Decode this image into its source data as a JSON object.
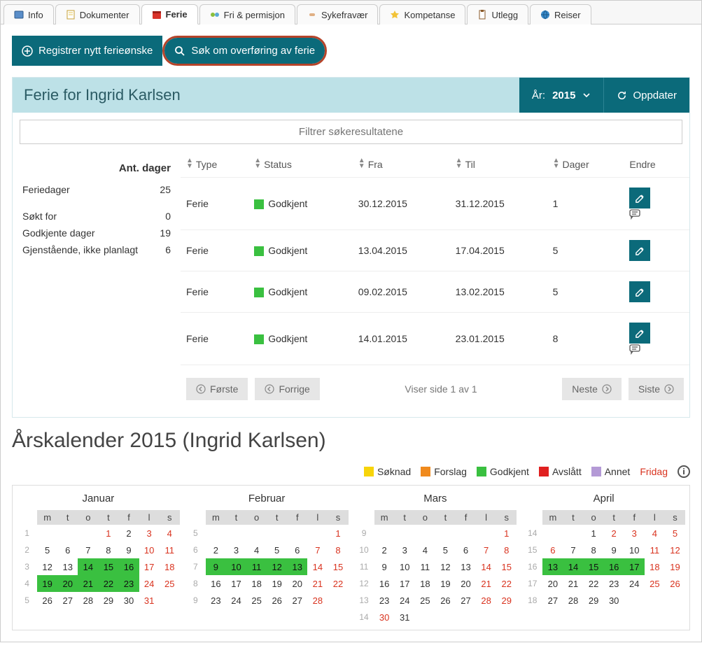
{
  "tabs": [
    {
      "label": "Info",
      "icon": "info-icon"
    },
    {
      "label": "Dokumenter",
      "icon": "doc-icon"
    },
    {
      "label": "Ferie",
      "icon": "calendar-icon",
      "active": true
    },
    {
      "label": "Fri & permisjon",
      "icon": "leave-icon"
    },
    {
      "label": "Sykefravær",
      "icon": "sick-icon"
    },
    {
      "label": "Kompetanse",
      "icon": "star-icon"
    },
    {
      "label": "Utlegg",
      "icon": "clipboard-icon"
    },
    {
      "label": "Reiser",
      "icon": "globe-icon"
    }
  ],
  "toolbar": {
    "register_label": "Registrer nytt ferieønske",
    "transfer_label": "Søk om overføring av ferie"
  },
  "panel": {
    "title": "Ferie for Ingrid Karlsen",
    "year_label": "År:",
    "year_value": "2015",
    "refresh_label": "Oppdater",
    "filter_placeholder": "Filtrer søkeresultatene"
  },
  "sidebar": {
    "title": "Ant. dager",
    "rows": [
      {
        "label": "Feriedager",
        "value": "25"
      },
      {
        "label": "Søkt for",
        "value": "0"
      },
      {
        "label": "Godkjente dager",
        "value": "19"
      },
      {
        "label": "Gjenstående, ikke planlagt",
        "value": "6"
      }
    ]
  },
  "table": {
    "headers": {
      "type": "Type",
      "status": "Status",
      "fra": "Fra",
      "til": "Til",
      "dager": "Dager",
      "endre": "Endre"
    },
    "rows": [
      {
        "type": "Ferie",
        "status": "Godkjent",
        "fra": "30.12.2015",
        "til": "31.12.2015",
        "dager": "1",
        "comment": true
      },
      {
        "type": "Ferie",
        "status": "Godkjent",
        "fra": "13.04.2015",
        "til": "17.04.2015",
        "dager": "5",
        "comment": false
      },
      {
        "type": "Ferie",
        "status": "Godkjent",
        "fra": "09.02.2015",
        "til": "13.02.2015",
        "dager": "5",
        "comment": false
      },
      {
        "type": "Ferie",
        "status": "Godkjent",
        "fra": "14.01.2015",
        "til": "23.01.2015",
        "dager": "8",
        "comment": true
      }
    ]
  },
  "pagination": {
    "first": "Første",
    "prev": "Forrige",
    "info": "Viser side 1 av 1",
    "next": "Neste",
    "last": "Siste"
  },
  "calendar": {
    "title": "Årskalender 2015 (Ingrid Karlsen)",
    "legend": {
      "soknad": "Søknad",
      "forslag": "Forslag",
      "godkjent": "Godkjent",
      "avslatt": "Avslått",
      "annet": "Annet",
      "fridag": "Fridag"
    },
    "colors": {
      "soknad": "#f7d40a",
      "forslag": "#f08a1d",
      "godkjent": "#3ac040",
      "avslatt": "#e02020",
      "annet": "#b49ad6"
    },
    "dow": [
      "m",
      "t",
      "o",
      "t",
      "f",
      "l",
      "s"
    ],
    "months": [
      {
        "name": "Januar",
        "weeks": [
          {
            "wk": "1",
            "days": [
              {
                "n": "",
                "c": ""
              },
              {
                "n": "",
                "c": ""
              },
              {
                "n": "",
                "c": ""
              },
              {
                "n": "1",
                "c": "red"
              },
              {
                "n": "2",
                "c": ""
              },
              {
                "n": "3",
                "c": "red"
              },
              {
                "n": "4",
                "c": "red"
              }
            ]
          },
          {
            "wk": "2",
            "days": [
              {
                "n": "5",
                "c": ""
              },
              {
                "n": "6",
                "c": ""
              },
              {
                "n": "7",
                "c": ""
              },
              {
                "n": "8",
                "c": ""
              },
              {
                "n": "9",
                "c": ""
              },
              {
                "n": "10",
                "c": "red"
              },
              {
                "n": "11",
                "c": "red"
              }
            ]
          },
          {
            "wk": "3",
            "days": [
              {
                "n": "12",
                "c": ""
              },
              {
                "n": "13",
                "c": ""
              },
              {
                "n": "14",
                "c": "godkjent"
              },
              {
                "n": "15",
                "c": "godkjent"
              },
              {
                "n": "16",
                "c": "godkjent"
              },
              {
                "n": "17",
                "c": "red"
              },
              {
                "n": "18",
                "c": "red"
              }
            ]
          },
          {
            "wk": "4",
            "days": [
              {
                "n": "19",
                "c": "godkjent"
              },
              {
                "n": "20",
                "c": "godkjent"
              },
              {
                "n": "21",
                "c": "godkjent"
              },
              {
                "n": "22",
                "c": "godkjent"
              },
              {
                "n": "23",
                "c": "godkjent"
              },
              {
                "n": "24",
                "c": "red"
              },
              {
                "n": "25",
                "c": "red"
              }
            ]
          },
          {
            "wk": "5",
            "days": [
              {
                "n": "26",
                "c": ""
              },
              {
                "n": "27",
                "c": ""
              },
              {
                "n": "28",
                "c": ""
              },
              {
                "n": "29",
                "c": ""
              },
              {
                "n": "30",
                "c": ""
              },
              {
                "n": "31",
                "c": "red"
              },
              {
                "n": "",
                "c": ""
              }
            ]
          }
        ]
      },
      {
        "name": "Februar",
        "weeks": [
          {
            "wk": "5",
            "days": [
              {
                "n": "",
                "c": ""
              },
              {
                "n": "",
                "c": ""
              },
              {
                "n": "",
                "c": ""
              },
              {
                "n": "",
                "c": ""
              },
              {
                "n": "",
                "c": ""
              },
              {
                "n": "",
                "c": ""
              },
              {
                "n": "1",
                "c": "red"
              }
            ]
          },
          {
            "wk": "6",
            "days": [
              {
                "n": "2",
                "c": ""
              },
              {
                "n": "3",
                "c": ""
              },
              {
                "n": "4",
                "c": ""
              },
              {
                "n": "5",
                "c": ""
              },
              {
                "n": "6",
                "c": ""
              },
              {
                "n": "7",
                "c": "red"
              },
              {
                "n": "8",
                "c": "red"
              }
            ]
          },
          {
            "wk": "7",
            "days": [
              {
                "n": "9",
                "c": "godkjent"
              },
              {
                "n": "10",
                "c": "godkjent"
              },
              {
                "n": "11",
                "c": "godkjent"
              },
              {
                "n": "12",
                "c": "godkjent"
              },
              {
                "n": "13",
                "c": "godkjent"
              },
              {
                "n": "14",
                "c": "red"
              },
              {
                "n": "15",
                "c": "red"
              }
            ]
          },
          {
            "wk": "8",
            "days": [
              {
                "n": "16",
                "c": ""
              },
              {
                "n": "17",
                "c": ""
              },
              {
                "n": "18",
                "c": ""
              },
              {
                "n": "19",
                "c": ""
              },
              {
                "n": "20",
                "c": ""
              },
              {
                "n": "21",
                "c": "red"
              },
              {
                "n": "22",
                "c": "red"
              }
            ]
          },
          {
            "wk": "9",
            "days": [
              {
                "n": "23",
                "c": ""
              },
              {
                "n": "24",
                "c": ""
              },
              {
                "n": "25",
                "c": ""
              },
              {
                "n": "26",
                "c": ""
              },
              {
                "n": "27",
                "c": ""
              },
              {
                "n": "28",
                "c": "red"
              },
              {
                "n": "",
                "c": ""
              }
            ]
          }
        ]
      },
      {
        "name": "Mars",
        "weeks": [
          {
            "wk": "9",
            "days": [
              {
                "n": "",
                "c": ""
              },
              {
                "n": "",
                "c": ""
              },
              {
                "n": "",
                "c": ""
              },
              {
                "n": "",
                "c": ""
              },
              {
                "n": "",
                "c": ""
              },
              {
                "n": "",
                "c": ""
              },
              {
                "n": "1",
                "c": "red"
              }
            ]
          },
          {
            "wk": "10",
            "days": [
              {
                "n": "2",
                "c": ""
              },
              {
                "n": "3",
                "c": ""
              },
              {
                "n": "4",
                "c": ""
              },
              {
                "n": "5",
                "c": ""
              },
              {
                "n": "6",
                "c": ""
              },
              {
                "n": "7",
                "c": "red"
              },
              {
                "n": "8",
                "c": "red"
              }
            ]
          },
          {
            "wk": "11",
            "days": [
              {
                "n": "9",
                "c": ""
              },
              {
                "n": "10",
                "c": ""
              },
              {
                "n": "11",
                "c": ""
              },
              {
                "n": "12",
                "c": ""
              },
              {
                "n": "13",
                "c": ""
              },
              {
                "n": "14",
                "c": "red"
              },
              {
                "n": "15",
                "c": "red"
              }
            ]
          },
          {
            "wk": "12",
            "days": [
              {
                "n": "16",
                "c": ""
              },
              {
                "n": "17",
                "c": ""
              },
              {
                "n": "18",
                "c": ""
              },
              {
                "n": "19",
                "c": ""
              },
              {
                "n": "20",
                "c": ""
              },
              {
                "n": "21",
                "c": "red"
              },
              {
                "n": "22",
                "c": "red"
              }
            ]
          },
          {
            "wk": "13",
            "days": [
              {
                "n": "23",
                "c": ""
              },
              {
                "n": "24",
                "c": ""
              },
              {
                "n": "25",
                "c": ""
              },
              {
                "n": "26",
                "c": ""
              },
              {
                "n": "27",
                "c": ""
              },
              {
                "n": "28",
                "c": "red"
              },
              {
                "n": "29",
                "c": "red"
              }
            ]
          },
          {
            "wk": "14",
            "days": [
              {
                "n": "30",
                "c": "red"
              },
              {
                "n": "31",
                "c": ""
              },
              {
                "n": "",
                "c": ""
              },
              {
                "n": "",
                "c": ""
              },
              {
                "n": "",
                "c": ""
              },
              {
                "n": "",
                "c": ""
              },
              {
                "n": "",
                "c": ""
              }
            ]
          }
        ]
      },
      {
        "name": "April",
        "weeks": [
          {
            "wk": "14",
            "days": [
              {
                "n": "",
                "c": ""
              },
              {
                "n": "",
                "c": ""
              },
              {
                "n": "1",
                "c": ""
              },
              {
                "n": "2",
                "c": "red"
              },
              {
                "n": "3",
                "c": "red"
              },
              {
                "n": "4",
                "c": "red"
              },
              {
                "n": "5",
                "c": "red"
              }
            ]
          },
          {
            "wk": "15",
            "days": [
              {
                "n": "6",
                "c": "red"
              },
              {
                "n": "7",
                "c": ""
              },
              {
                "n": "8",
                "c": ""
              },
              {
                "n": "9",
                "c": ""
              },
              {
                "n": "10",
                "c": ""
              },
              {
                "n": "11",
                "c": "red"
              },
              {
                "n": "12",
                "c": "red"
              }
            ]
          },
          {
            "wk": "16",
            "days": [
              {
                "n": "13",
                "c": "godkjent"
              },
              {
                "n": "14",
                "c": "godkjent"
              },
              {
                "n": "15",
                "c": "godkjent"
              },
              {
                "n": "16",
                "c": "godkjent"
              },
              {
                "n": "17",
                "c": "godkjent"
              },
              {
                "n": "18",
                "c": "red"
              },
              {
                "n": "19",
                "c": "red"
              }
            ]
          },
          {
            "wk": "17",
            "days": [
              {
                "n": "20",
                "c": ""
              },
              {
                "n": "21",
                "c": ""
              },
              {
                "n": "22",
                "c": ""
              },
              {
                "n": "23",
                "c": ""
              },
              {
                "n": "24",
                "c": ""
              },
              {
                "n": "25",
                "c": "red"
              },
              {
                "n": "26",
                "c": "red"
              }
            ]
          },
          {
            "wk": "18",
            "days": [
              {
                "n": "27",
                "c": ""
              },
              {
                "n": "28",
                "c": ""
              },
              {
                "n": "29",
                "c": ""
              },
              {
                "n": "30",
                "c": ""
              },
              {
                "n": "",
                "c": ""
              },
              {
                "n": "",
                "c": ""
              },
              {
                "n": "",
                "c": ""
              }
            ]
          }
        ]
      }
    ]
  }
}
